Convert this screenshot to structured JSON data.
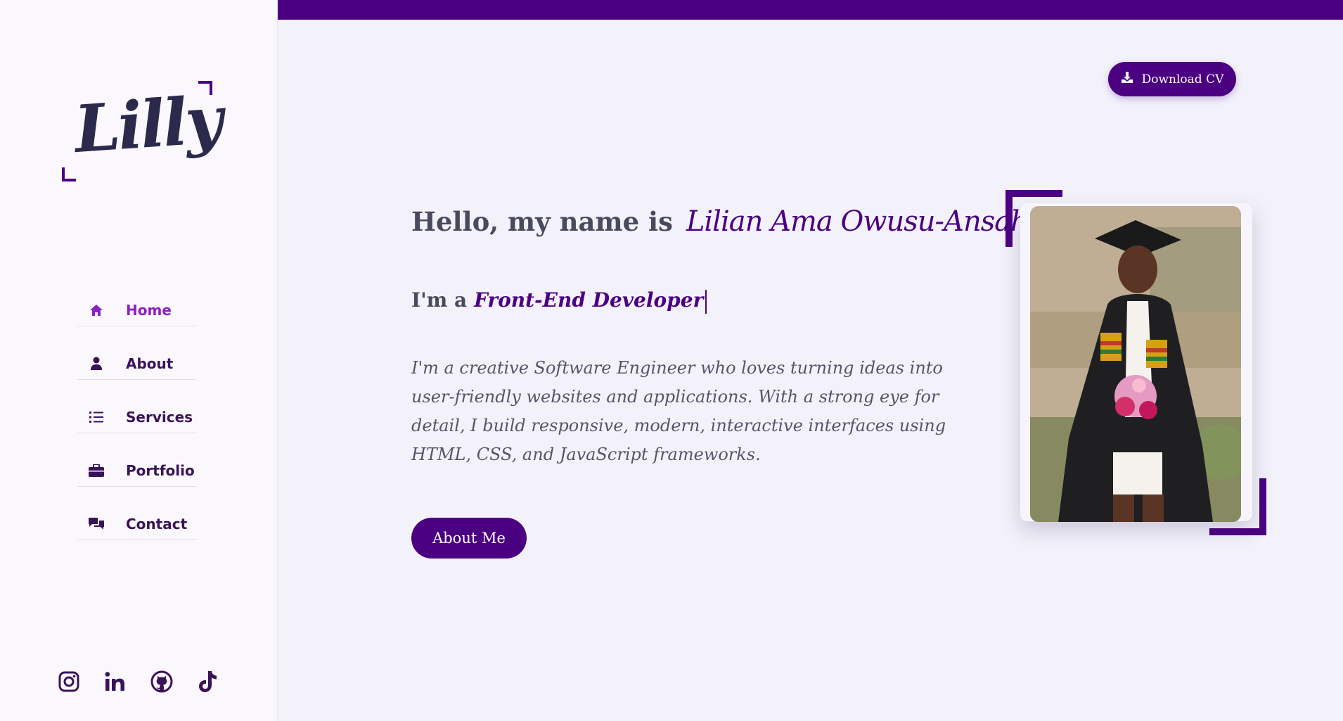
{
  "sidebar": {
    "logo_text": "Lilly",
    "nav": [
      {
        "label": "Home",
        "icon": "home-icon",
        "active": true
      },
      {
        "label": "About",
        "icon": "user-icon",
        "active": false
      },
      {
        "label": "Services",
        "icon": "list-icon",
        "active": false
      },
      {
        "label": "Portfolio",
        "icon": "briefcase-icon",
        "active": false
      },
      {
        "label": "Contact",
        "icon": "chat-icon",
        "active": false
      }
    ],
    "socials": [
      "instagram-icon",
      "linkedin-icon",
      "github-icon",
      "tiktok-icon"
    ]
  },
  "header": {
    "download_label": "Download CV"
  },
  "hero": {
    "greeting": "Hello, my name is",
    "name": "Lilian Ama Owusu-Ansah",
    "role_prefix": "I'm a",
    "role": "Front-End Developer",
    "bio": "I'm a creative Software Engineer who loves turning ideas into user-friendly websites and applications. With a strong eye for detail, I build responsive, modern, interactive interfaces using HTML, CSS, and JavaScript frameworks.",
    "cta_label": "About Me"
  },
  "colors": {
    "accent": "#4b0082",
    "active_nav": "#8b20c9",
    "background": "#f3f2fb",
    "sidebar_bg": "#fbf8fd"
  }
}
